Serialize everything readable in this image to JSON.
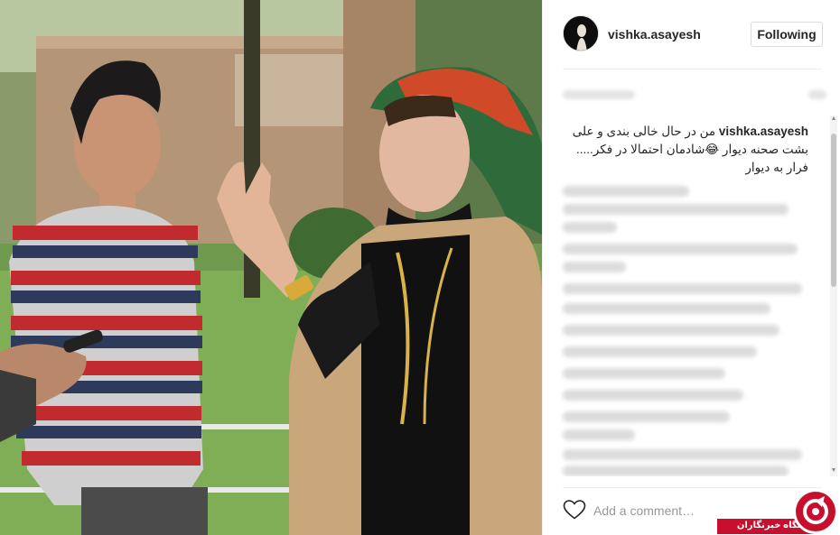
{
  "post": {
    "username": "vishka.asayesh",
    "follow_label": "Following",
    "caption_user": "vishka.asayesh",
    "caption_text": "من در حال خالی بندی و علی بشت صحنه دیوار 😂شادمان احتمالا در فکر..... فرار به دیوار"
  },
  "footer": {
    "comment_placeholder": "Add a comment…"
  },
  "watermark": {
    "text": "باشگاه خبرنگاران"
  },
  "colors": {
    "accent_red": "#c8102e",
    "follow_border": "#dbdbdb",
    "text": "#262626"
  },
  "icons": {
    "like": "heart-outline-icon",
    "avatar": "profile-avatar",
    "watermark_logo": "yjc-logo-icon"
  }
}
